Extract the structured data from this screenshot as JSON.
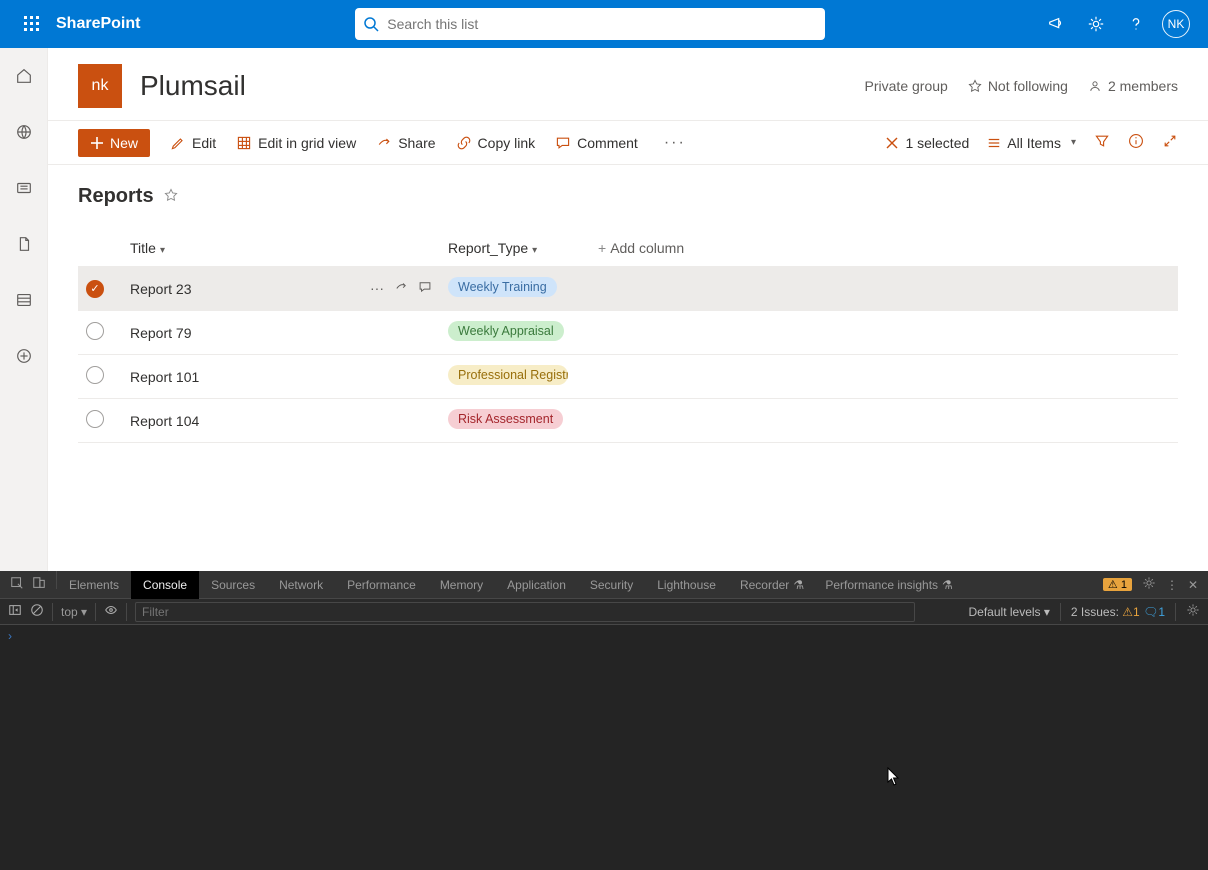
{
  "header": {
    "brand": "SharePoint",
    "search_placeholder": "Search this list",
    "avatar_initials": "NK"
  },
  "site": {
    "logo_initials": "nk",
    "title": "Plumsail",
    "privacy": "Private group",
    "following_label": "Not following",
    "members_count": "2 members"
  },
  "toolbar": {
    "new_label": "New",
    "edit_label": "Edit",
    "grid_label": "Edit in grid view",
    "share_label": "Share",
    "copy_label": "Copy link",
    "comment_label": "Comment",
    "selected_label": "1 selected",
    "view_label": "All Items"
  },
  "list": {
    "title": "Reports",
    "columns": {
      "title": "Title",
      "type": "Report_Type",
      "add": "Add column"
    },
    "rows": [
      {
        "title": "Report 23",
        "type": "Weekly Training",
        "pill_class": "pill-blue",
        "selected": true
      },
      {
        "title": "Report 79",
        "type": "Weekly Appraisal",
        "pill_class": "pill-green",
        "selected": false
      },
      {
        "title": "Report 101",
        "type": "Professional Registrat",
        "pill_class": "pill-yellow",
        "selected": false
      },
      {
        "title": "Report 104",
        "type": "Risk Assessment",
        "pill_class": "pill-red",
        "selected": false
      }
    ]
  },
  "devtools": {
    "tabs": [
      "Elements",
      "Console",
      "Sources",
      "Network",
      "Performance",
      "Memory",
      "Application",
      "Security",
      "Lighthouse",
      "Recorder",
      "Performance insights"
    ],
    "active_tab": "Console",
    "warn_count": "1",
    "context": "top",
    "filter_placeholder": "Filter",
    "levels": "Default levels",
    "issues_label": "2 Issues:",
    "issues_warn": "1",
    "issues_info": "1"
  }
}
